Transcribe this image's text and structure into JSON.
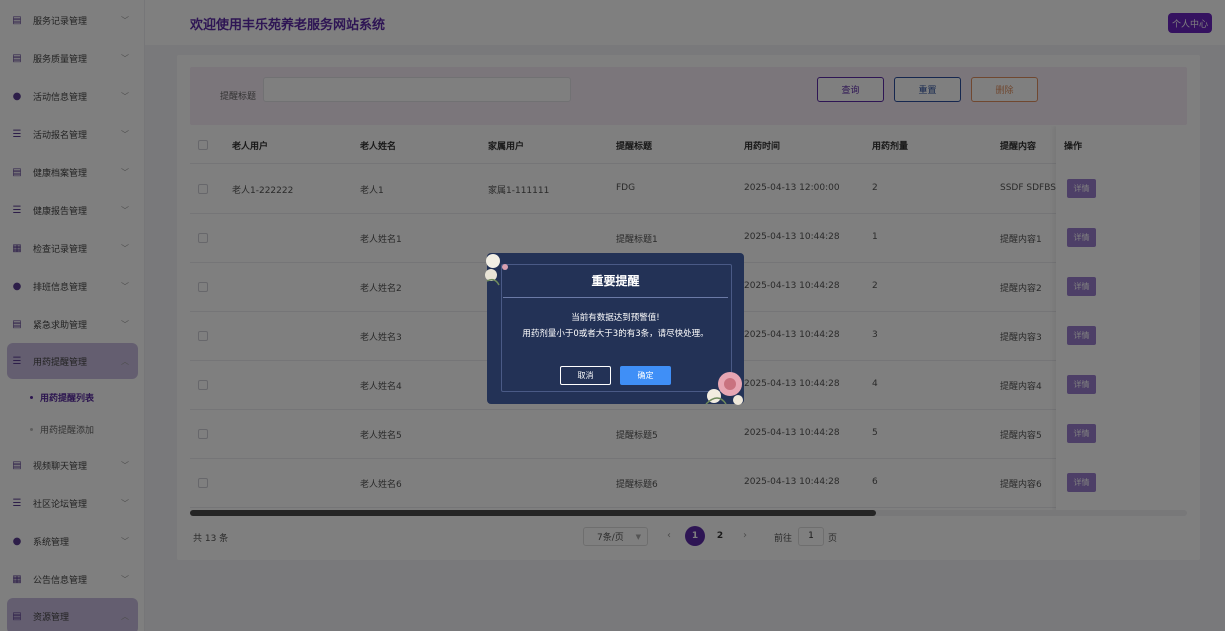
{
  "header": {
    "title": "欢迎使用丰乐苑养老服务网站系统",
    "user_center": "个人中心"
  },
  "sidebar": {
    "items": [
      {
        "label": "服务记录管理",
        "icon": "doc-icon"
      },
      {
        "label": "服务质量管理",
        "icon": "doc-icon"
      },
      {
        "label": "活动信息管理",
        "icon": "drop-icon"
      },
      {
        "label": "活动报名管理",
        "icon": "list-icon"
      },
      {
        "label": "健康档案管理",
        "icon": "doc-icon"
      },
      {
        "label": "健康报告管理",
        "icon": "list-icon"
      },
      {
        "label": "检查记录管理",
        "icon": "box-icon"
      },
      {
        "label": "排班信息管理",
        "icon": "drop-icon"
      },
      {
        "label": "紧急求助管理",
        "icon": "doc-icon"
      },
      {
        "label": "用药提醒管理",
        "icon": "list-icon"
      },
      {
        "label": "视频聊天管理",
        "icon": "doc-icon"
      },
      {
        "label": "社区论坛管理",
        "icon": "list-icon"
      },
      {
        "label": "系统管理",
        "icon": "drop-icon"
      },
      {
        "label": "公告信息管理",
        "icon": "box-icon"
      },
      {
        "label": "资源管理",
        "icon": "doc-icon"
      }
    ],
    "sub_items": [
      {
        "label": "用药提醒列表"
      },
      {
        "label": "用药提醒添加"
      }
    ]
  },
  "search": {
    "label": "提醒标题",
    "placeholder": "",
    "query_btn": "查询",
    "reset_btn": "重置",
    "delete_btn": "删除"
  },
  "table": {
    "headers": [
      "老人用户",
      "老人姓名",
      "家属用户",
      "提醒标题",
      "用药时间",
      "用药剂量",
      "提醒内容",
      "操作"
    ],
    "detail_label": "详情",
    "rows": [
      {
        "elder_user": "老人1-222222",
        "elder_name": "老人1",
        "family_user": "家属1-111111",
        "title": "FDG",
        "time": "2025-04-13 12:00:00",
        "dose": "2",
        "content": "SSDF SDFBSD"
      },
      {
        "elder_user": "",
        "elder_name": "老人姓名1",
        "family_user": "",
        "title": "提醒标题1",
        "time": "2025-04-13 10:44:28",
        "dose": "1",
        "content": "提醒内容1"
      },
      {
        "elder_user": "",
        "elder_name": "老人姓名2",
        "family_user": "",
        "title": "",
        "time": "2025-04-13 10:44:28",
        "dose": "2",
        "content": "提醒内容2"
      },
      {
        "elder_user": "",
        "elder_name": "老人姓名3",
        "family_user": "",
        "title": "",
        "time": "2025-04-13 10:44:28",
        "dose": "3",
        "content": "提醒内容3"
      },
      {
        "elder_user": "",
        "elder_name": "老人姓名4",
        "family_user": "",
        "title": "",
        "time": "2025-04-13 10:44:28",
        "dose": "4",
        "content": "提醒内容4"
      },
      {
        "elder_user": "",
        "elder_name": "老人姓名5",
        "family_user": "",
        "title": "提醒标题5",
        "time": "2025-04-13 10:44:28",
        "dose": "5",
        "content": "提醒内容5"
      },
      {
        "elder_user": "",
        "elder_name": "老人姓名6",
        "family_user": "",
        "title": "提醒标题6",
        "time": "2025-04-13 10:44:28",
        "dose": "6",
        "content": "提醒内容6"
      }
    ]
  },
  "pagination": {
    "total": "共 13 条",
    "page_size": "7条/页",
    "pages": [
      "1",
      "2"
    ],
    "goto_label": "前往",
    "goto_value": "1",
    "goto_unit": "页"
  },
  "dialog": {
    "title": "重要提醒",
    "message_line1": "当前有数据达到预警值!",
    "message_line2": "用药剂量小于0或者大于3的有3条，请尽快处理。",
    "cancel": "取消",
    "ok": "确定"
  },
  "colors": {
    "accent": "#5c2aa8",
    "dialog_bg": "#233256",
    "ok_button": "#3f8ff7"
  }
}
